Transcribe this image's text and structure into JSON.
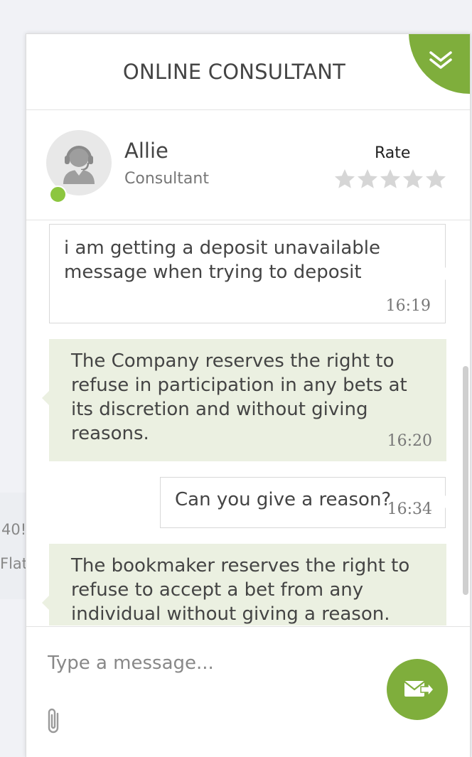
{
  "background": {
    "snippet1": "40!",
    "snippet2": "Flat"
  },
  "header": {
    "title": "ONLINE CONSULTANT",
    "collapse_icon": "double-chevron-down-icon"
  },
  "agent": {
    "name": "Allie",
    "role": "Consultant",
    "status": "online",
    "rate_label": "Rate",
    "rating": 0,
    "max_rating": 5
  },
  "messages": [
    {
      "from": "user",
      "text": "i am getting a deposit unavailable message when trying to deposit",
      "time": "16:19"
    },
    {
      "from": "agent",
      "text": "The Company reserves the right to refuse in participation in any bets at its discretion and without giving reasons.",
      "time": "16:20"
    },
    {
      "from": "user",
      "text": "Can you give a reason?",
      "time": "16:34"
    },
    {
      "from": "agent",
      "text": "The bookmaker reserves the right to refuse to accept a bet from any individual without giving a reason.",
      "time": ""
    }
  ],
  "composer": {
    "placeholder": "Type a message...",
    "value": ""
  },
  "colors": {
    "accent": "#7fae3c",
    "online": "#8cc63f",
    "agent_bubble": "#ebf0e1"
  }
}
